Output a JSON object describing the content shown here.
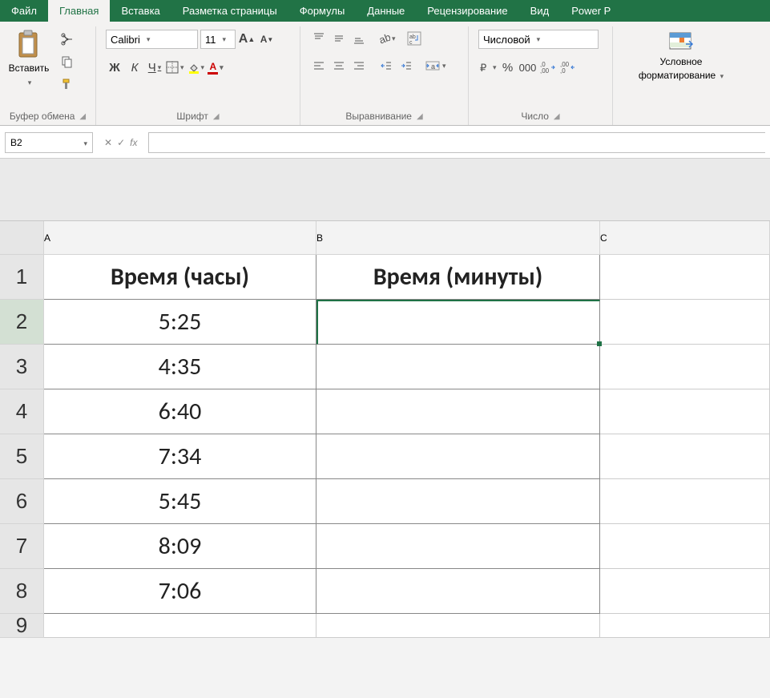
{
  "tabs": {
    "file": "Файл",
    "home": "Главная",
    "insert": "Вставка",
    "page_layout": "Разметка страницы",
    "formulas": "Формулы",
    "data": "Данные",
    "review": "Рецензирование",
    "view": "Вид",
    "powerpivot": "Power P"
  },
  "ribbon": {
    "clipboard": {
      "paste": "Вставить",
      "label": "Буфер обмена"
    },
    "font": {
      "name": "Calibri",
      "size": "11",
      "bold": "Ж",
      "italic": "К",
      "underline": "Ч",
      "label": "Шрифт",
      "inc": "A",
      "dec": "A"
    },
    "alignment": {
      "label": "Выравнивание"
    },
    "number": {
      "format": "Числовой",
      "label": "Число"
    },
    "cond": {
      "line1": "Условное",
      "line2": "форматирование"
    }
  },
  "formula_bar": {
    "name_box": "B2"
  },
  "sheet": {
    "columns": [
      "A",
      "B",
      "C"
    ],
    "rows": [
      "1",
      "2",
      "3",
      "4",
      "5",
      "6",
      "7",
      "8",
      "9"
    ],
    "header_A": "Время (часы)",
    "header_B": "Время (минуты)",
    "data": {
      "A2": "5:25",
      "A3": "4:35",
      "A4": "6:40",
      "A5": "7:34",
      "A6": "5:45",
      "A7": "8:09",
      "A8": "7:06"
    }
  }
}
